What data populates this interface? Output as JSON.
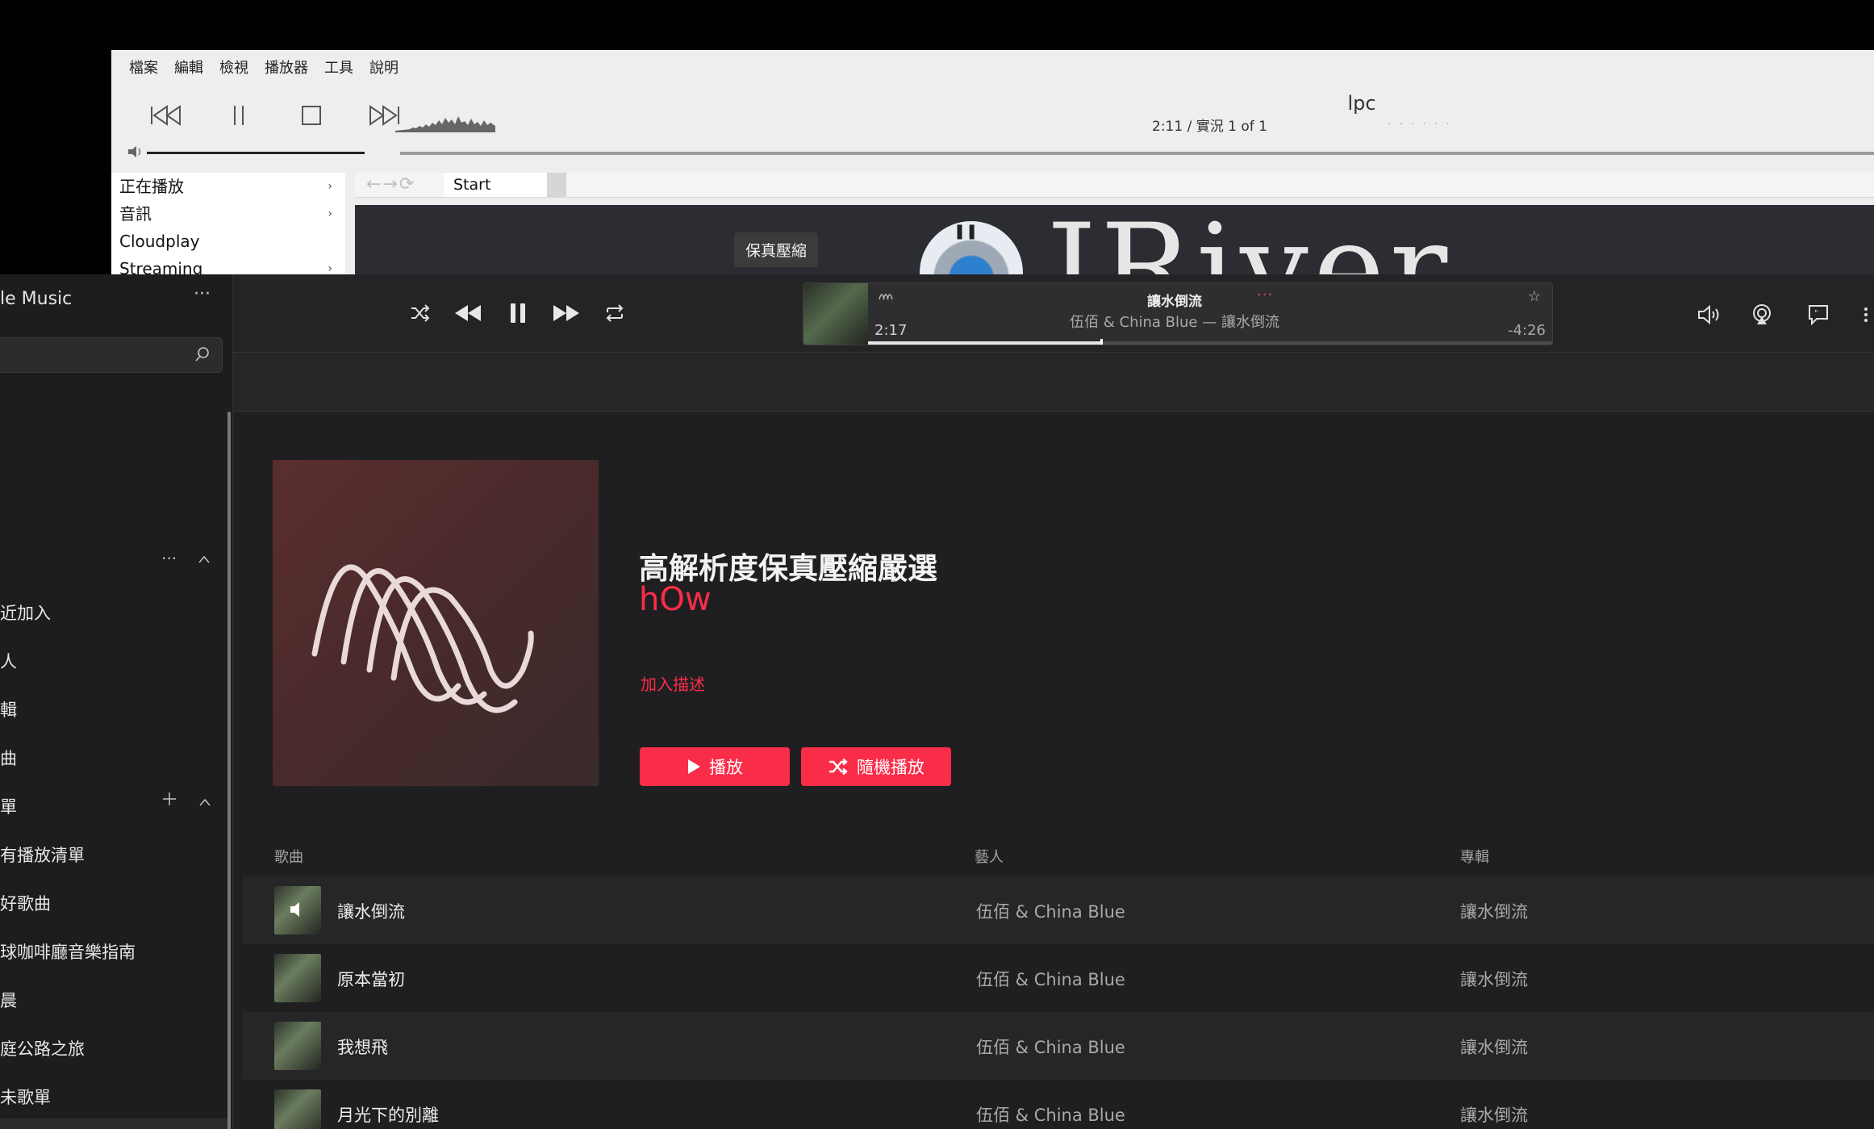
{
  "jriver": {
    "menu": [
      "檔案",
      "編輯",
      "檢視",
      "播放器",
      "工具",
      "說明"
    ],
    "now_title": "lpc",
    "status": "2:11 / 實況   1 of 1",
    "tree": [
      {
        "label": "正在播放",
        "arrow": "›"
      },
      {
        "label": "音訊",
        "arrow": "›"
      },
      {
        "label": "Cloudplay",
        "arrow": ""
      },
      {
        "label": "Streaming",
        "arrow": "›"
      }
    ],
    "tab": "Start",
    "logo_text": "JRiver",
    "tooltip": "保真壓縮"
  },
  "apple_music": {
    "brand": "le Music",
    "brand_more": "···",
    "sidebar": {
      "library_items": [
        "近加入",
        "人",
        "輯",
        "曲"
      ],
      "playlist_header": "單",
      "playlists": [
        "有播放清單",
        "好歌曲",
        "球咖啡廳音樂指南",
        "晨",
        "庭公路之旅",
        "未歌單"
      ]
    },
    "now_playing": {
      "title": "讓水倒流",
      "more": "···",
      "artist_line": "伍佰 & China Blue — 讓水倒流",
      "elapsed": "2:17",
      "remaining": "-4:26",
      "progress": 0.34
    },
    "playlist": {
      "title": "高解析度保真壓縮嚴選",
      "owner": "hOw",
      "add_description": "加入描述",
      "play_label": "播放",
      "shuffle_label": "隨機播放"
    },
    "columns": {
      "song": "歌曲",
      "artist": "藝人",
      "album": "專輯"
    },
    "tracks": [
      {
        "song": "讓水倒流",
        "artist": "伍佰 & China Blue",
        "album": "讓水倒流",
        "playing": true
      },
      {
        "song": "原本當初",
        "artist": "伍佰 & China Blue",
        "album": "讓水倒流",
        "playing": false
      },
      {
        "song": "我想飛",
        "artist": "伍佰 & China Blue",
        "album": "讓水倒流",
        "playing": false
      },
      {
        "song": "月光下的別離",
        "artist": "伍佰 & China Blue",
        "album": "讓水倒流",
        "playing": false
      }
    ],
    "colors": {
      "accent": "#fa2d48",
      "background": "#1f1f21"
    }
  }
}
